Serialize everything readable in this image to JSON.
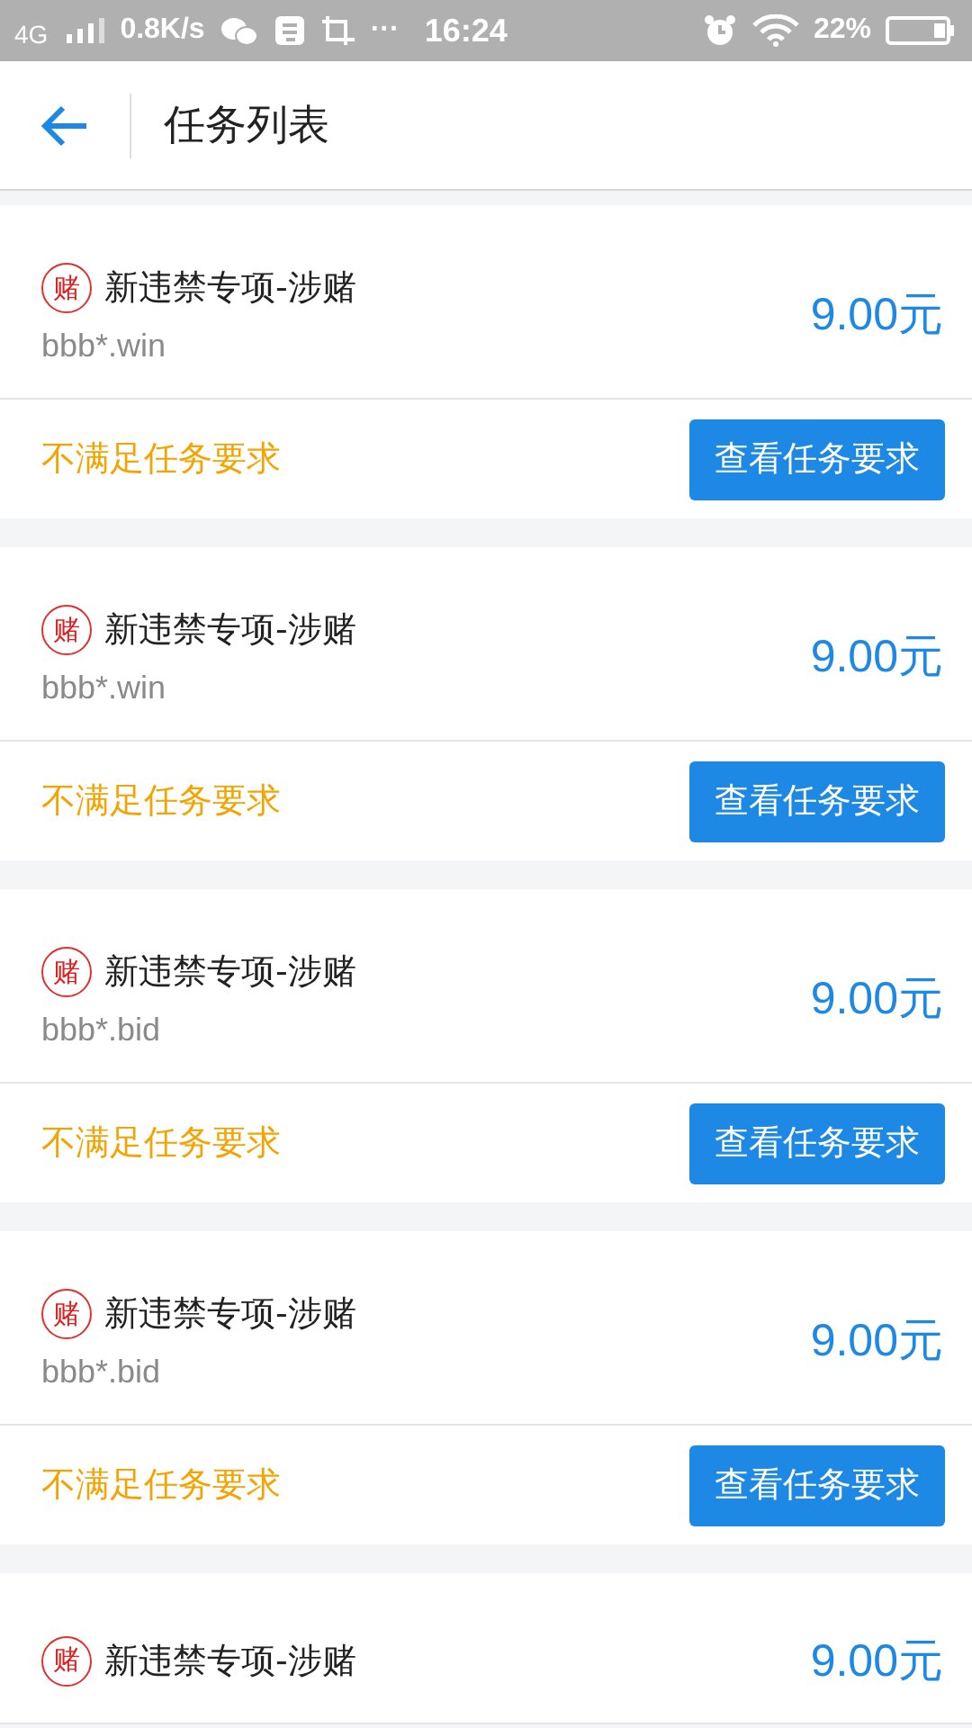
{
  "status_bar": {
    "network": "4G",
    "speed": "0.8K/s",
    "more": "···",
    "time": "16:24",
    "battery": "22%"
  },
  "header": {
    "title": "任务列表"
  },
  "tasks": [
    {
      "badge": "赌",
      "title": "新违禁专项-涉赌",
      "domain": "bbb*.win",
      "price": "9.00元",
      "status": "不满足任务要求",
      "button": "查看任务要求"
    },
    {
      "badge": "赌",
      "title": "新违禁专项-涉赌",
      "domain": "bbb*.win",
      "price": "9.00元",
      "status": "不满足任务要求",
      "button": "查看任务要求"
    },
    {
      "badge": "赌",
      "title": "新违禁专项-涉赌",
      "domain": "bbb*.bid",
      "price": "9.00元",
      "status": "不满足任务要求",
      "button": "查看任务要求"
    },
    {
      "badge": "赌",
      "title": "新违禁专项-涉赌",
      "domain": "bbb*.bid",
      "price": "9.00元",
      "status": "不满足任务要求",
      "button": "查看任务要求"
    },
    {
      "badge": "赌",
      "title": "新违禁专项-涉赌",
      "price": "9.00元"
    }
  ]
}
